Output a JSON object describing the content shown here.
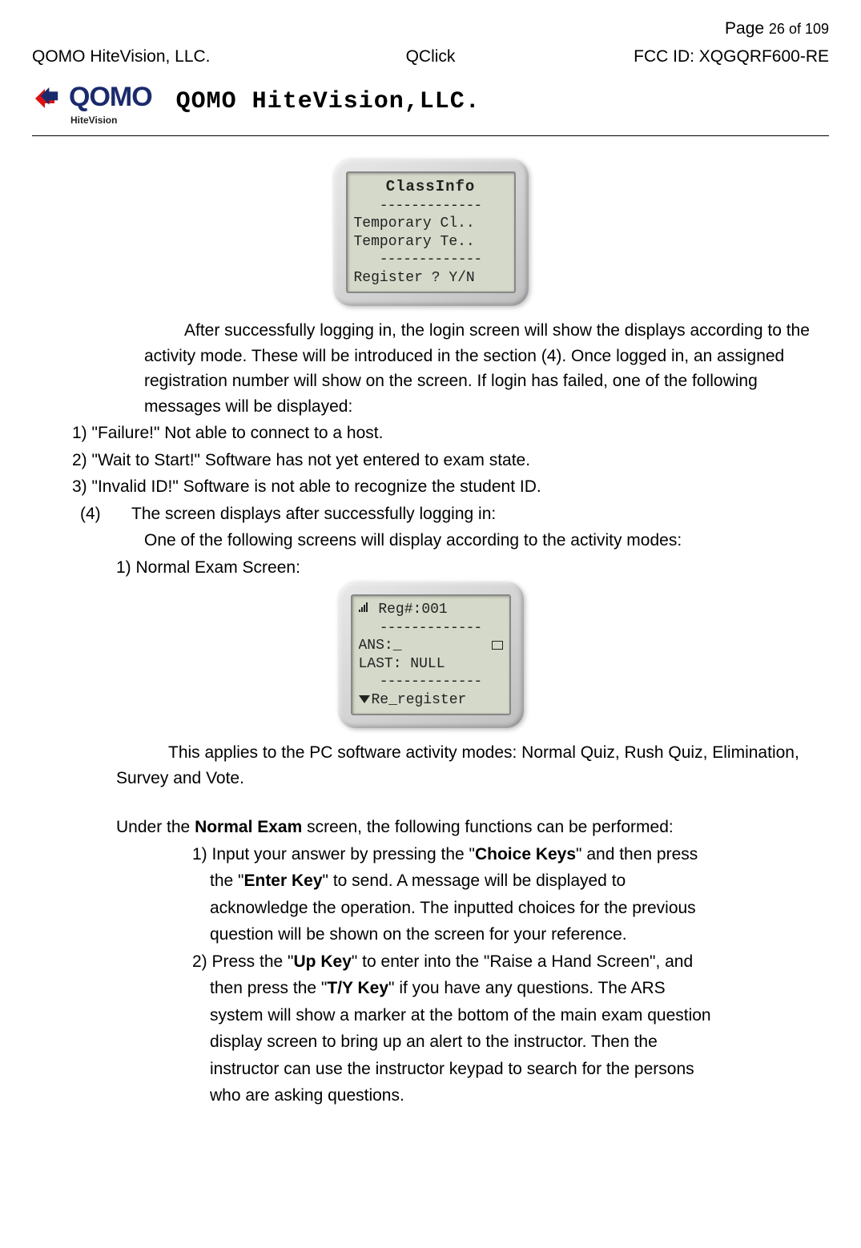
{
  "header": {
    "company_left": "QOMO HiteVision, LLC.",
    "product": "QClick",
    "page_label_prefix": "Page ",
    "page_current": "26",
    "page_of": " of ",
    "page_total": "109",
    "fcc": "FCC ID: XQGQRF600-RE",
    "logo_text": "QOMO",
    "logo_sub": "HiteVision",
    "company_title": "QOMO HiteVision,LLC."
  },
  "screen1": {
    "title": "ClassInfo",
    "dash": "-------------",
    "line1": "Temporary Cl..",
    "line2": "Temporary Te..",
    "foot": "Register ? Y/N"
  },
  "body": {
    "p1": "After successfully logging in, the login screen will show the displays according to the activity mode. These will be introduced in the section (4). Once logged in, an assigned registration number will show on the screen. If login has failed, one of the following messages will be displayed:",
    "f1": "1) \"Failure!\" Not able to connect to a host.",
    "f2": "2) \"Wait to Start!\" Software has not yet entered to exam state.",
    "f3": "3) \"Invalid ID!\" Software is not able to recognize the student ID.",
    "sec4_num": "(4)",
    "sec4_text": "The screen displays after successfully logging in:",
    "sec4_sub": "One of the following screens will display according to the activity modes:",
    "mode1_label": "1)  Normal Exam Screen:"
  },
  "screen2": {
    "reg": "Reg#:001",
    "ans": "ANS:_",
    "last": "LAST: NULL",
    "dash": "-------------",
    "rereg": "Re_register"
  },
  "applies": {
    "line": "This applies to the PC software activity modes: Normal Quiz, Rush Quiz, Elimination, Survey and Vote."
  },
  "normal": {
    "intro_pre": "Under the ",
    "intro_bold": "Normal Exam",
    "intro_post": " screen, the following functions can be performed:",
    "i1_a": "1) Input your answer by pressing the \"",
    "i1_b": "Choice Keys",
    "i1_c": "\" and then press",
    "i1_d": "the \"",
    "i1_e": "Enter Key",
    "i1_f": "\" to send. A message will be displayed to",
    "i1_g": "acknowledge the operation. The inputted choices for the previous",
    "i1_h": "question will be shown on the screen for your reference.",
    "i2_a": "2) Press the \"",
    "i2_b": "Up Key",
    "i2_c": "\" to enter into the \"Raise a Hand Screen\", and",
    "i2_d": "then press the \"",
    "i2_e": "T/Y Key",
    "i2_f": "\" if you have any questions. The ARS",
    "i2_g": "system will show a marker at the bottom of the main exam question",
    "i2_h": "display screen to bring up an alert to the instructor. Then the",
    "i2_i": "instructor can use the instructor keypad to search for the persons",
    "i2_j": "who are asking questions."
  }
}
